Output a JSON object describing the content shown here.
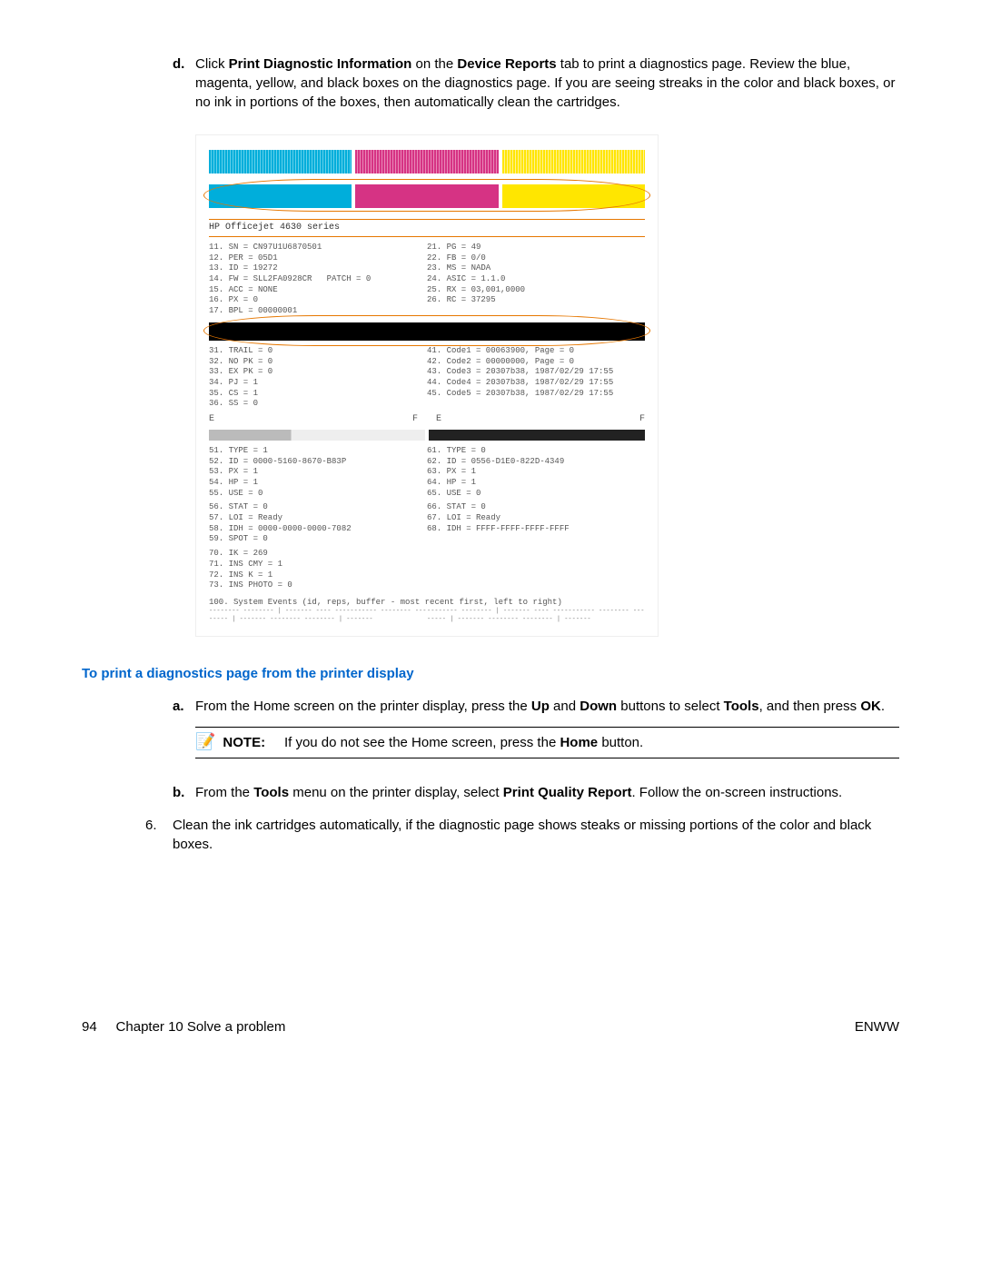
{
  "step_d_letter": "d.",
  "step_d_text_1": "Click ",
  "step_d_bold_1": "Print Diagnostic Information",
  "step_d_text_2": " on the ",
  "step_d_bold_2": "Device Reports",
  "step_d_text_3": " tab to print a diagnostics page. Review the blue, magenta, yellow, and black boxes on the diagnostics page. If you are seeing streaks in the color and black boxes, or no ink in portions of the boxes, then automatically clean the cartridges.",
  "diag_title": "HP Officejet 4630 series",
  "diag_left_1": "11. SN = CN97U1U6870501\n12. PER = 05D1\n13. ID = 19272\n14. FW = SLL2FA0928CR   PATCH = 0\n15. ACC = NONE\n16. PX = 0\n17. BPL = 00000001",
  "diag_right_1": "21. PG = 49\n22. FB = 0/0\n23. MS = NADA\n24. ASIC = 1.1.0\n25. RX = 03,001,0000\n26. RC = 37295",
  "diag_left_2": "31. TRAIL = 0\n32. NO PK = 0\n33. EX PK = 0\n34. PJ = 1\n35. CS = 1\n36. SS = 0",
  "diag_right_2": "41. Code1 = 00063900, Page = 0\n42. Code2 = 00000000, Page = 0\n43. Code3 = 20307b38, 1987/02/29 17:55\n44. Code4 = 20307b38, 1987/02/29 17:55\n45. Code5 = 20307b38, 1987/02/29 17:55",
  "diag_left_3": "51. TYPE = 1\n52. ID = 0000-5160-8670-B83P\n53. PX = 1\n54. HP = 1\n55. USE = 0",
  "diag_right_3": "61. TYPE = 0\n62. ID = 0556-D1E0-822D-4349\n63. PX = 1\n64. HP = 1\n65. USE = 0",
  "diag_left_4": "56. STAT = 0\n57. LOI = Ready\n58. IDH = 0000-0000-0000-7082\n59. SPOT = 0",
  "diag_right_4": "66. STAT = 0\n67. LOI = Ready\n68. IDH = FFFF-FFFF-FFFF-FFFF",
  "diag_left_5": "70. IK = 269\n71. INS CMY = 1\n72. INS K = 1\n73. INS PHOTO = 0",
  "diag_bottom": "100. System Events (id, reps, buffer - most recent first, left to right)",
  "diag_tiny": "-------- -------- | ------- ---- -----------\n-------- -------- | -------\n-------- -------- | -------",
  "section_title": "To print a diagnostics page from the printer display",
  "step_a_letter": "a.",
  "step_a_text_1": "From the Home screen on the printer display, press the ",
  "step_a_bold_1": "Up",
  "step_a_text_2": " and ",
  "step_a_bold_2": "Down",
  "step_a_text_3": " buttons to select ",
  "step_a_bold_3": "Tools",
  "step_a_text_4": ", and then press ",
  "step_a_bold_4": "OK",
  "step_a_text_5": ".",
  "note_label": "NOTE:",
  "note_text_1": "If you do not see the Home screen, press the ",
  "note_bold": "Home",
  "note_text_2": " button.",
  "step_b_letter": "b.",
  "step_b_text_1": "From the ",
  "step_b_bold_1": "Tools",
  "step_b_text_2": " menu on the printer display, select ",
  "step_b_bold_2": "Print Quality Report",
  "step_b_text_3": ". Follow the on-screen instructions.",
  "step6_num": "6.",
  "step6_text": "Clean the ink cartridges automatically, if the diagnostic page shows steaks or missing portions of the color and black boxes.",
  "footer_page": "94",
  "footer_chapter": "Chapter 10   Solve a problem",
  "footer_right": "ENWW"
}
